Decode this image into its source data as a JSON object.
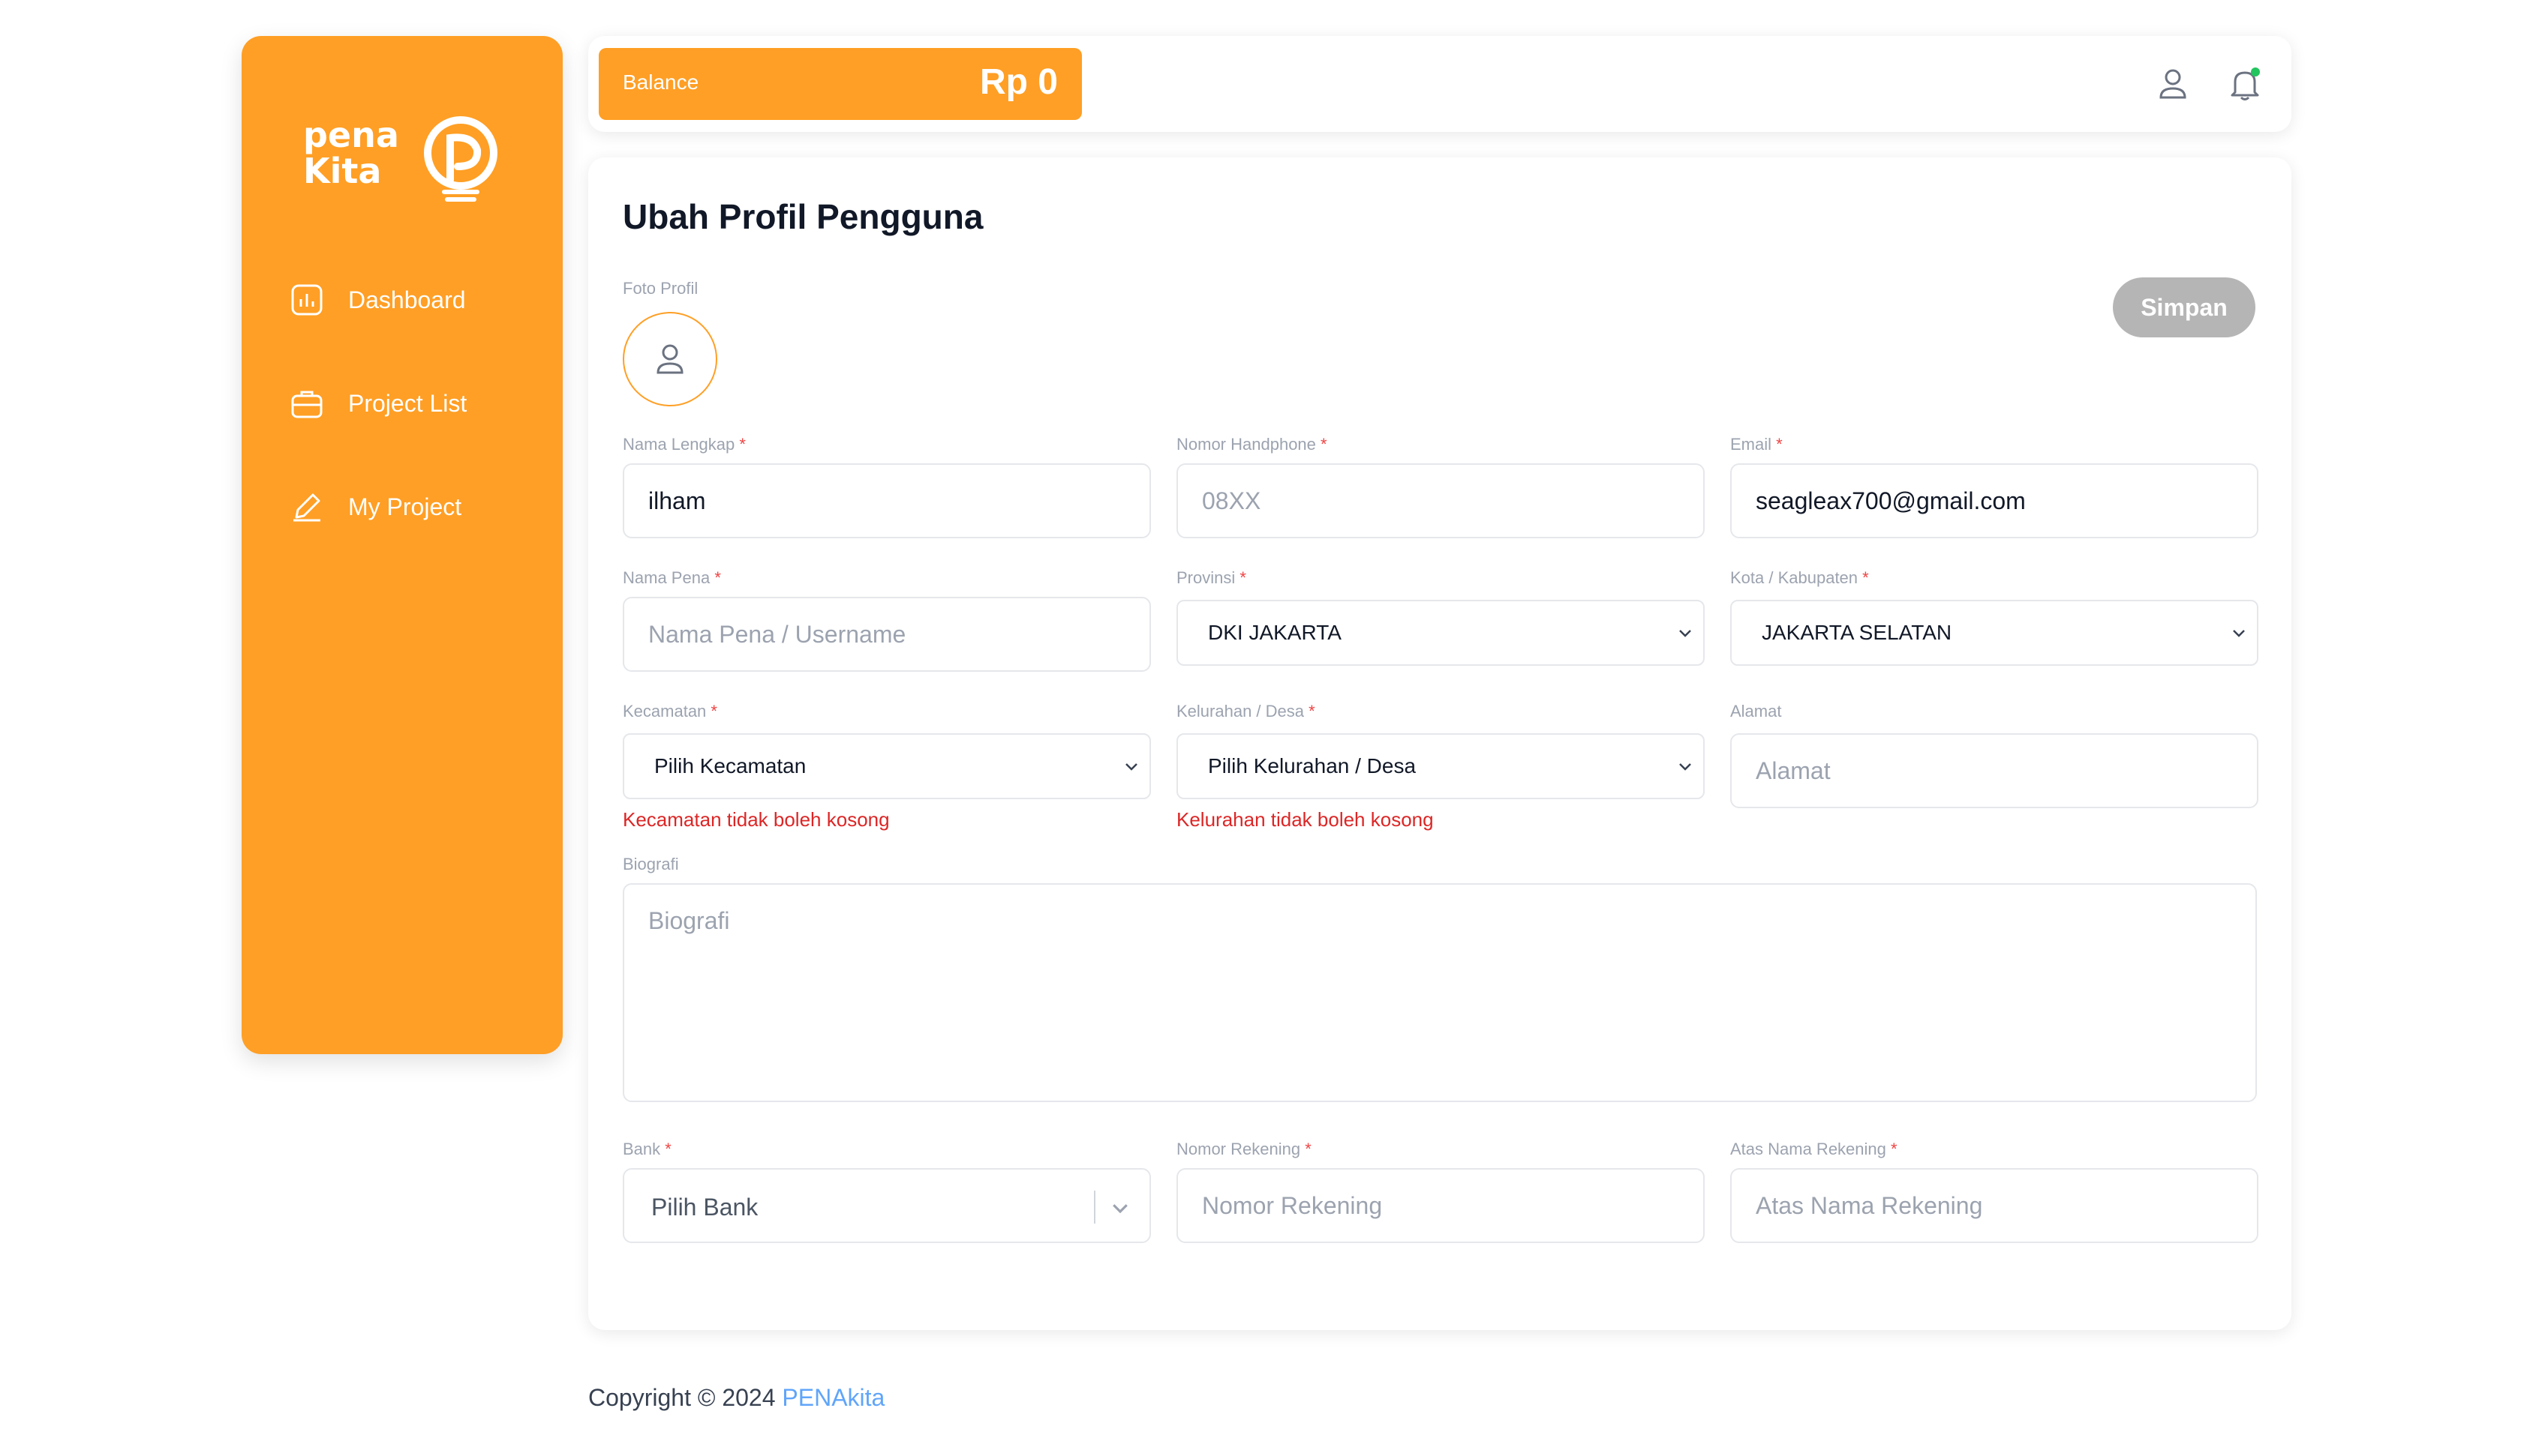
{
  "sidebar": {
    "logo_text": [
      "pena",
      "Kita"
    ],
    "items": [
      {
        "label": "Dashboard",
        "icon": "chart-icon"
      },
      {
        "label": "Project List",
        "icon": "briefcase-icon"
      },
      {
        "label": "My Project",
        "icon": "pencil-icon"
      }
    ]
  },
  "topbar": {
    "balance_label": "Balance",
    "balance_amount": "Rp 0",
    "icons": [
      "user-icon",
      "bell-icon"
    ]
  },
  "form": {
    "title": "Ubah Profil Pengguna",
    "photo_label": "Foto Profil",
    "save_label": "Simpan",
    "required_mark": "*",
    "full_name": {
      "label": "Nama Lengkap",
      "value": "ilham"
    },
    "phone": {
      "label": "Nomor Handphone",
      "placeholder": "08XX"
    },
    "email": {
      "label": "Email",
      "value": "seagleax700@gmail.com"
    },
    "pen_name": {
      "label": "Nama Pena",
      "placeholder": "Nama Pena / Username"
    },
    "province": {
      "label": "Provinsi",
      "value": "DKI JAKARTA"
    },
    "city": {
      "label": "Kota / Kabupaten",
      "value": "JAKARTA SELATAN"
    },
    "district": {
      "label": "Kecamatan",
      "value": "Pilih Kecamatan",
      "error": "Kecamatan tidak boleh kosong"
    },
    "village": {
      "label": "Kelurahan / Desa",
      "value": "Pilih Kelurahan / Desa",
      "error": "Kelurahan tidak boleh kosong"
    },
    "address": {
      "label": "Alamat",
      "placeholder": "Alamat"
    },
    "bio": {
      "label": "Biografi",
      "placeholder": "Biografi"
    },
    "bank": {
      "label": "Bank",
      "placeholder": "Pilih Bank"
    },
    "account_number": {
      "label": "Nomor Rekening",
      "placeholder": "Nomor Rekening"
    },
    "account_name": {
      "label": "Atas Nama Rekening",
      "placeholder": "Atas Nama Rekening"
    }
  },
  "footer": {
    "text": "Copyright © 2024 ",
    "brand": "PENAkita"
  },
  "colors": {
    "brand": "#FF9F25",
    "error": "#dc2626",
    "link": "#60a5fa",
    "status_dot": "#22c55e"
  }
}
